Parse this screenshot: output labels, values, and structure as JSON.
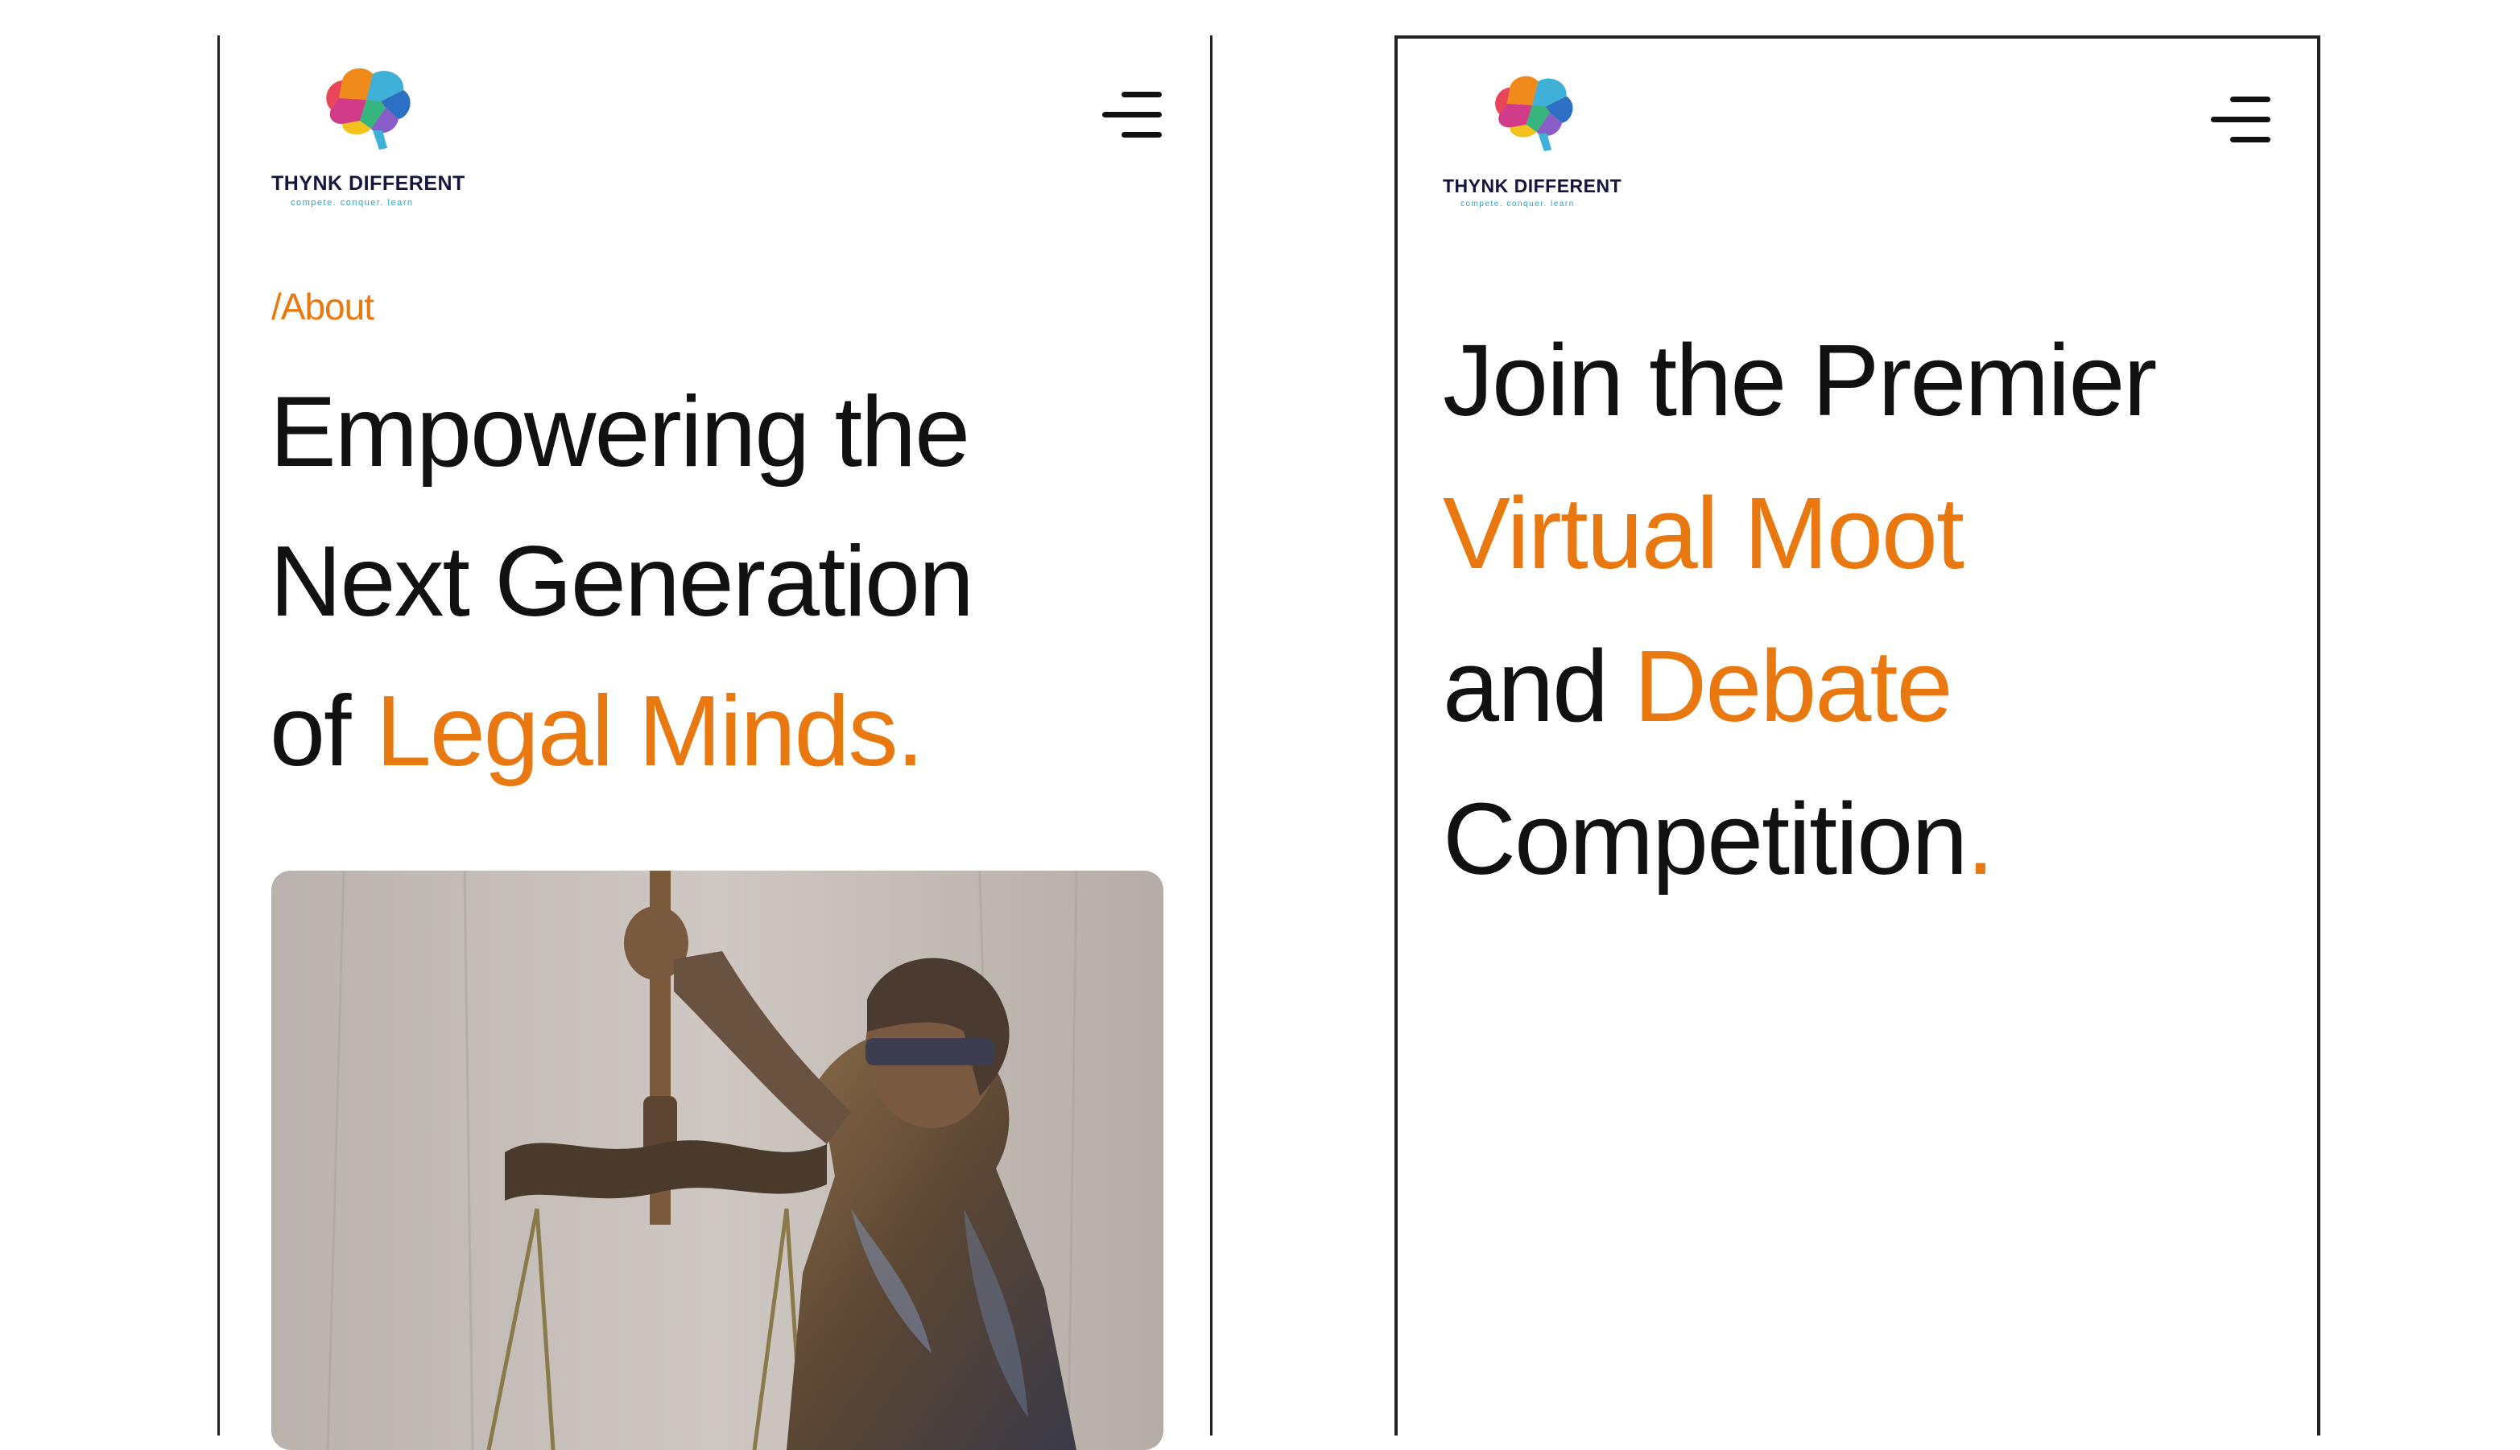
{
  "brand": {
    "name": "THYNK DIFFERENT",
    "tagline": "compete. conquer. learn"
  },
  "menu": {
    "icon": "hamburger-menu-icon"
  },
  "about_screen": {
    "breadcrumb": "/About",
    "title": {
      "line1": "Empowering the",
      "line2": "Next Generation",
      "line3_prefix": "of ",
      "line3_accent": "Legal Minds."
    },
    "image": {
      "subject": "lady-justice-statue-icon"
    }
  },
  "competition_screen": {
    "title": {
      "line1": "Join the Premier",
      "line2_accent": "Virtual Moot",
      "line3_prefix": "and ",
      "line3_accent": "Debate",
      "line4": "Competition",
      "line4_accent": "."
    }
  },
  "colors": {
    "accent": "#e8780f",
    "text": "#111111",
    "brand_navy": "#15153f",
    "tagline": "#27a3c4"
  }
}
